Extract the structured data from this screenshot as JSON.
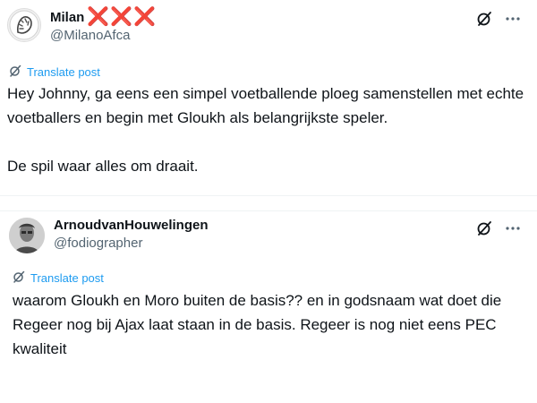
{
  "posts": [
    {
      "display_name": "Milan",
      "name_suffix": "❌❌❌",
      "handle": "@MilanoAfca",
      "avatar_icon": "ajax-logo-icon",
      "translate_label": "Translate post",
      "paragraphs": [
        "Hey Johnny, ga eens een simpel voetballende ploeg samenstellen met echte voetballers en begin met Gloukh als belangrijkste speler.",
        "De spil waar alles om draait."
      ]
    },
    {
      "display_name": "ArnoudvanHouwelingen",
      "handle": "@fodiographer",
      "avatar_icon": "profile-photo",
      "translate_label": "Translate post",
      "paragraphs": [
        "waarom Gloukh en Moro buiten de basis?? en in godsnaam wat doet die Regeer nog bij Ajax laat staan in de basis. Regeer is nog niet eens PEC kwaliteit"
      ]
    }
  ],
  "icons": {
    "grok": "grok-icon",
    "more": "more-icon",
    "translate": "translate-icon"
  },
  "colors": {
    "link": "#1d9bf0",
    "text": "#0f1419",
    "muted": "#536471",
    "suffix": "#e0245e"
  }
}
